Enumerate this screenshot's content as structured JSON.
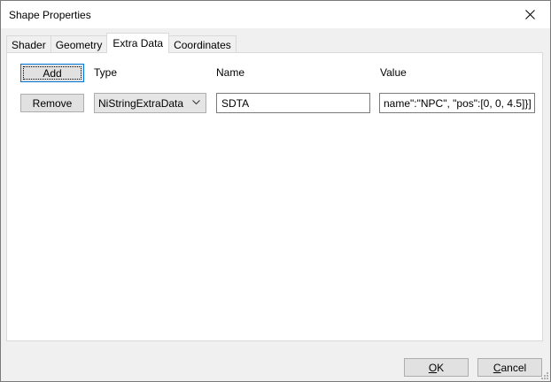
{
  "window": {
    "title": "Shape Properties"
  },
  "tabs": [
    {
      "label": "Shader"
    },
    {
      "label": "Geometry"
    },
    {
      "label": "Extra Data"
    },
    {
      "label": "Coordinates"
    }
  ],
  "columns": {
    "type": "Type",
    "name": "Name",
    "value": "Value"
  },
  "buttons": {
    "add": "Add",
    "remove": "Remove"
  },
  "row": {
    "type": "NiStringExtraData",
    "name": "SDTA",
    "value": "name\":\"NPC\", \"pos\":[0, 0, 4.5]}]"
  },
  "footer": {
    "ok_accel": "O",
    "ok_rest": "K",
    "cancel_accel": "C",
    "cancel_rest": "ancel"
  },
  "icons": {
    "close": "close-icon",
    "dropdown": "chevron-down-icon"
  }
}
